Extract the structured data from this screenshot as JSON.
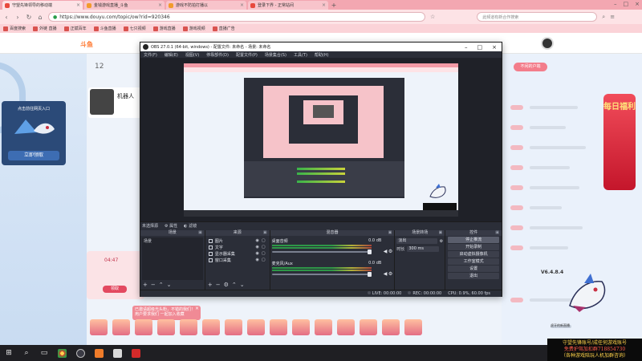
{
  "browser": {
    "tabs": [
      {
        "label": "守望先锋领导的移动端",
        "color": "#e8493d",
        "active": true
      },
      {
        "label": "金钱游戏直播_斗鱼",
        "color": "#f29b2b",
        "active": false
      },
      {
        "label": "游戏不防拍打播以",
        "color": "#f29b2b",
        "active": false
      },
      {
        "label": "登录下界 - 正常站间",
        "color": "#e8493d",
        "active": false
      }
    ],
    "url": "https://www.douyu.com/topic/ow?rid=920346",
    "search_placeholder": "此频道有新合作搜索",
    "bookmarks": [
      "百度搜索",
      "外链 直播",
      "正斌百年",
      "斗鱼直播",
      "七只视频",
      "游戏直播",
      "游戏视频",
      "直播广告"
    ]
  },
  "page": {
    "rank_number": "12",
    "streamer_name": "机器人",
    "qr_card_title": "点击前往网页入口",
    "qr_card_button": "立即领取",
    "count_card_time": "04:47",
    "count_card_button": "领取",
    "invite_text": "已邀请超级光头粉，不错的我们！用户要求我们 一起加入收藏",
    "promo_button": "不闲的户端",
    "banner_text": "每日福利",
    "version": "V6.4.8.4",
    "gift_caption": "虎牙的新直播"
  },
  "obs": {
    "title": "OBS 27.0.1 (64-bit, windows) - 配置文件: 未命名 - 场景: 未命名",
    "menu": [
      "文件(F)",
      "编辑(E)",
      "视图(V)",
      "停靠部件(D)",
      "配置文件(P)",
      "场景集合(S)",
      "工具(T)",
      "帮助(H)"
    ],
    "toolbar": {
      "selected": "未选择源",
      "props": "属性",
      "filters": "滤镜"
    },
    "docks": {
      "scenes": {
        "header": "场景",
        "items": [
          "场景"
        ]
      },
      "sources": {
        "header": "来源",
        "items": [
          "图片",
          "文字",
          "显示器采集",
          "窗口采集"
        ]
      },
      "mixer": {
        "header": "混音器",
        "tracks": [
          {
            "name": "桌面音频",
            "db": "0.0 dB"
          },
          {
            "name": "麦克风/Aux",
            "db": "0.0 dB"
          }
        ]
      },
      "transitions": {
        "header": "场景转场",
        "type": "淡出",
        "duration_label": "时长",
        "duration": "300 ms"
      },
      "controls": {
        "header": "控件",
        "buttons": [
          "停止推流",
          "开始录制",
          "启动虚拟摄像机",
          "工作室模式",
          "设置",
          "退出"
        ]
      }
    },
    "status": {
      "live": "LIVE: 00:00:00",
      "rec": "REC: 00:00:00",
      "cpu": "CPU: 0.9%, 60.00 fps"
    }
  },
  "overlay": {
    "line1": "守望先锋账号/成任何游戏账号",
    "line2": "免费护驾加扣群718854730",
    "line3": "（各种游戏陪玩人机加群咨询）"
  },
  "colors": {
    "browser_accent": "#f3a7b1",
    "obs_bg": "#2b2e38",
    "brand": "#ff7a33"
  }
}
